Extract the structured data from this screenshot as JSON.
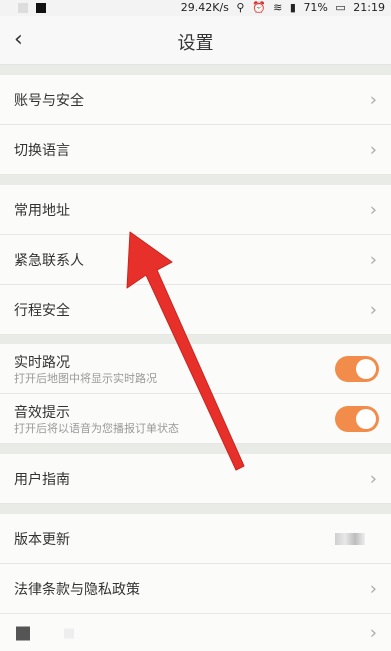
{
  "statusbar": {
    "speed": "29.42K/s",
    "battery": "71%",
    "time": "21:19"
  },
  "header": {
    "back_icon": "‹",
    "title": "设置"
  },
  "settings": {
    "account_security": "账号与安全",
    "switch_language": "切换语言",
    "common_address": "常用地址",
    "emergency_contact": "紧急联系人",
    "trip_safety": "行程安全",
    "realtime_traffic": {
      "label": "实时路况",
      "desc": "打开后地图中将显示实时路况",
      "enabled": true
    },
    "sound_prompt": {
      "label": "音效提示",
      "desc": "打开后将以语音为您播报订单状态",
      "enabled": true
    },
    "user_guide": "用户指南",
    "version_update": "版本更新",
    "legal_privacy": "法律条款与隐私政策"
  },
  "colors": {
    "toggle_on": "#f28c4b",
    "arrow": "#e8302a",
    "section_gap": "#e9ece6"
  }
}
